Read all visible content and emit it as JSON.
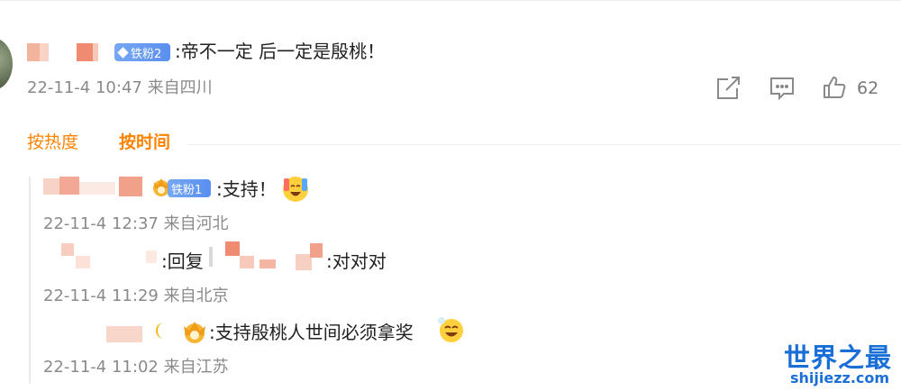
{
  "comment": {
    "badge": "铁粉2",
    "text": ":帝不一定 后一定是殷桃！",
    "time": "22-11-4 10:47",
    "location": "来自四川",
    "like_count": "62"
  },
  "sort": {
    "hot": "按热度",
    "time": "按时间"
  },
  "replies": [
    {
      "badge": "铁粉1",
      "text": ":支持！",
      "time": "22-11-4 12:37",
      "location": "来自河北"
    },
    {
      "text_prefix": ":回复",
      "text": ":对对对",
      "time": "22-11-4 11:29",
      "location": "来自北京"
    },
    {
      "text": ":支持殷桃人世间必须拿奖",
      "time": "22-11-4 11:02",
      "location": "来自江苏"
    }
  ],
  "watermark": {
    "logo_text": "世界之最",
    "domain": "shijiezz.com"
  },
  "colors": {
    "accent": "#ff8200",
    "badge": "#5b8ff0",
    "watermark": "#1a6fd6"
  }
}
